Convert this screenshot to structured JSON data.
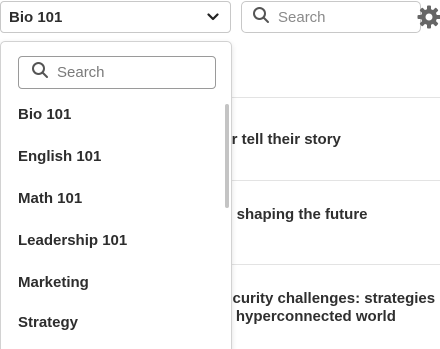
{
  "header": {
    "course_selected": "Bio 101",
    "search_placeholder": "Search"
  },
  "dropdown": {
    "search_placeholder": "Search",
    "items": [
      {
        "label": "Bio 101"
      },
      {
        "label": "English 101"
      },
      {
        "label": "Math 101"
      },
      {
        "label": "Leadership 101"
      },
      {
        "label": "Marketing"
      },
      {
        "label": "Strategy"
      }
    ]
  },
  "background_items": [
    {
      "line1": "mer tell their story"
    },
    {
      "line1": "ds: shaping the future"
    },
    {
      "line1": "rsecurity challenges: strategies",
      "line2": "n a hyperconnected world"
    }
  ],
  "icons": {
    "chevron": "chevron-down-icon",
    "search": "search-icon",
    "settings": "gear-icon"
  }
}
